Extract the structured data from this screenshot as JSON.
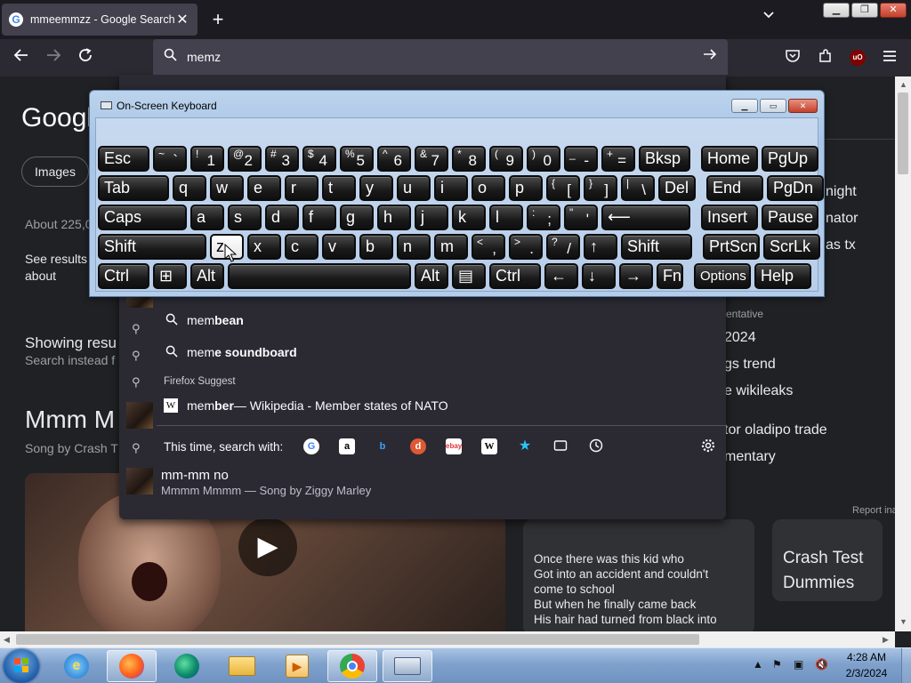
{
  "browser": {
    "tab_title": "mmeemmzz - Google Search",
    "tab_close": "✕",
    "new_tab": "+",
    "url_text": "memz",
    "window_buttons": {
      "min": "▁",
      "max": "❐",
      "close": "✕"
    }
  },
  "page": {
    "logo": "Googl",
    "images_chip": "Images",
    "about": "About 225,0",
    "see_results": "See results about",
    "showing": "Showing resu",
    "instead": "Search instead f",
    "big_title": "Mmm M",
    "song_by": "Song by Crash T",
    "lyrics": [
      "Once there was this kid who",
      "Got into an accident and couldn't",
      "come to school",
      "But when he finally came back",
      "His hair had turned from black into"
    ],
    "band_card": [
      "Crash Test",
      "Dummies"
    ],
    "side_items": [
      "night",
      "nator",
      "as tx",
      "entative",
      "2024",
      "gs trend",
      "e wikileaks",
      "tor oladipo trade",
      "mentary"
    ],
    "report": "Report ina"
  },
  "dropdown": {
    "suggestions": [
      {
        "prefix": "mem",
        "bold": "bean",
        "suffix": ""
      },
      {
        "prefix": "mem",
        "bold": "e soundboard",
        "suffix": ""
      }
    ],
    "firefox_suggest_label": "Firefox Suggest",
    "wiki": {
      "prefix": "mem",
      "bold": "ber",
      "suffix": " — Wikipedia - Member states of NATO"
    },
    "this_time": "This time, search with:",
    "result_title": "mm-mm no",
    "result_sub": "Mmmm Mmmm — Song by Ziggy Marley"
  },
  "osk": {
    "title": "On-Screen Keyboard",
    "rows": [
      [
        {
          "lbl": "Esc"
        },
        {
          "sh": "~",
          "mn": "`"
        },
        {
          "sh": "!",
          "mn": "1"
        },
        {
          "sh": "@",
          "mn": "2"
        },
        {
          "sh": "#",
          "mn": "3"
        },
        {
          "sh": "$",
          "mn": "4"
        },
        {
          "sh": "%",
          "mn": "5"
        },
        {
          "sh": "^",
          "mn": "6"
        },
        {
          "sh": "&",
          "mn": "7"
        },
        {
          "sh": "*",
          "mn": "8"
        },
        {
          "sh": "(",
          "mn": "9"
        },
        {
          "sh": ")",
          "mn": "0"
        },
        {
          "sh": "_",
          "mn": "-"
        },
        {
          "sh": "+",
          "mn": "="
        },
        {
          "lbl": "Bksp"
        },
        {
          "lbl": "Home"
        },
        {
          "lbl": "PgUp"
        }
      ],
      [
        {
          "lbl": "Tab"
        },
        {
          "lbl": "q"
        },
        {
          "lbl": "w"
        },
        {
          "lbl": "e"
        },
        {
          "lbl": "r"
        },
        {
          "lbl": "t"
        },
        {
          "lbl": "y"
        },
        {
          "lbl": "u"
        },
        {
          "lbl": "i"
        },
        {
          "lbl": "o"
        },
        {
          "lbl": "p"
        },
        {
          "sh": "{",
          "mn": "["
        },
        {
          "sh": "}",
          "mn": "]"
        },
        {
          "sh": "|",
          "mn": "\\"
        },
        {
          "lbl": "Del"
        },
        {
          "lbl": "End"
        },
        {
          "lbl": "PgDn"
        }
      ],
      [
        {
          "lbl": "Caps"
        },
        {
          "lbl": "a"
        },
        {
          "lbl": "s"
        },
        {
          "lbl": "d"
        },
        {
          "lbl": "f"
        },
        {
          "lbl": "g"
        },
        {
          "lbl": "h"
        },
        {
          "lbl": "j"
        },
        {
          "lbl": "k"
        },
        {
          "lbl": "l"
        },
        {
          "sh": ":",
          "mn": ";"
        },
        {
          "sh": "\"",
          "mn": "'"
        },
        {
          "lbl": "⟵"
        },
        {
          "lbl": "Insert"
        },
        {
          "lbl": "Pause"
        }
      ],
      [
        {
          "lbl": "Shift"
        },
        {
          "lbl": "z"
        },
        {
          "lbl": "x"
        },
        {
          "lbl": "c"
        },
        {
          "lbl": "v"
        },
        {
          "lbl": "b"
        },
        {
          "lbl": "n"
        },
        {
          "lbl": "m"
        },
        {
          "sh": "<",
          "mn": ","
        },
        {
          "sh": ">",
          "mn": "."
        },
        {
          "sh": "?",
          "mn": "/"
        },
        {
          "lbl": "↑"
        },
        {
          "lbl": "Shift"
        },
        {
          "lbl": "PrtScn"
        },
        {
          "lbl": "ScrLk"
        }
      ],
      [
        {
          "lbl": "Ctrl"
        },
        {
          "lbl": "⊞"
        },
        {
          "lbl": "Alt"
        },
        {
          "lbl": ""
        },
        {
          "lbl": "Alt"
        },
        {
          "lbl": "▤"
        },
        {
          "lbl": "Ctrl"
        },
        {
          "lbl": "←"
        },
        {
          "lbl": "↓"
        },
        {
          "lbl": "→"
        },
        {
          "lbl": "Fn"
        },
        {
          "lbl": "Options"
        },
        {
          "lbl": "Help"
        }
      ]
    ],
    "pressed_key": "z"
  },
  "taskbar": {
    "time": "4:28 AM",
    "date": "2/3/2024"
  },
  "colors": {
    "accent": "#1c5ca8",
    "key_bg": "#1a1a1a",
    "ublock": "#800000"
  }
}
